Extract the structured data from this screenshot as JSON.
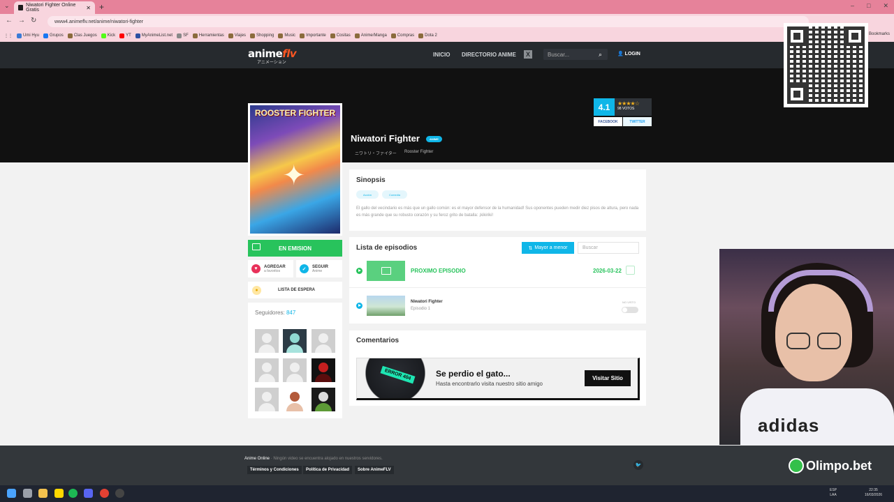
{
  "browser": {
    "tab_title": "Niwatori Fighter Online Gratis",
    "url": "www4.animeflv.net/anime/niwatori-fighter",
    "bookmarks": [
      "Umi Hyu",
      "Grupos",
      "Clas Juegos",
      "Kick",
      "YT",
      "MyAnimeList.net",
      "SF",
      "Herramientas",
      "Viajes",
      "Shopping",
      "Music",
      "Importante",
      "Cositas",
      "Anime/Manga",
      "Compras",
      "Dota 2"
    ],
    "bookmarks_right": "Bookmarks"
  },
  "site": {
    "logo_main": "anime",
    "logo_accent": "flv",
    "logo_sub": "アニメーション",
    "nav": [
      "INICIO",
      "DIRECTORIO ANIME"
    ],
    "search_placeholder": "Buscar...",
    "login": "LOGIN"
  },
  "anime": {
    "poster_title": "ROOSTER FIGHTER",
    "title": "Niwatori Fighter",
    "type": "ANIME",
    "alt_titles": [
      "ニワトリ・ファイター",
      "Rooster Fighter"
    ],
    "rating": "4.1",
    "stars": "★★★★☆",
    "votes": "98 VOTOS",
    "share": [
      "FACEBOOK",
      "TWITTER"
    ],
    "status": "EN EMISION",
    "actions": [
      {
        "label": "AGREGAR",
        "sub": "a favoritos"
      },
      {
        "label": "SEGUIR",
        "sub": "Anime"
      }
    ],
    "waitlist": "LISTA DE ESPERA",
    "followers_label": "Seguidores:",
    "followers_count": "847"
  },
  "synopsis": {
    "heading": "Sinopsis",
    "genres": [
      "Acción",
      "Comedia"
    ],
    "text": "El gallo del vecindario es más que un gallo común: es el mayor defensor de la humanidad! Sus oponentes pueden medir diez pisos de altura, pero nada es más grande que su robusto corazón y su feroz grito de batalla: ¡kikiriki!"
  },
  "episodes": {
    "heading": "Lista de episodios",
    "sort_label": "Mayor a menor",
    "search_placeholder": "Buscar",
    "next_label": "PROXIMO EPISODIO",
    "next_date": "2026-03-22",
    "items": [
      {
        "name": "Niwatori Fighter",
        "number": "Episodio 1",
        "status": "NO VISTO"
      }
    ]
  },
  "comments": {
    "heading": "Comentarios",
    "error_tag": "ERROR 404",
    "banner_title": "Se perdio el gato...",
    "banner_sub": "Hasta encontrarlo visita nuestro sitio amigo",
    "banner_button": "Visitar Sitio"
  },
  "footer": {
    "brand": "Anime Online",
    "disclaimer": "Ningún video se encuentra alojado en nuestros servidores.",
    "links": [
      "Términos y Condiciones",
      "Política de Privacidad",
      "Sobre AnimeFLV"
    ]
  },
  "overlay": {
    "sponsor": "Olimpo.bet",
    "shirt_text": "adidas"
  },
  "taskbar": {
    "lang": "ESP",
    "lang_sub": "LAA",
    "time": "22:35",
    "date": "16/03/2026"
  },
  "colors": {
    "accent": "#0fb6e8",
    "green": "#28c35c",
    "header": "#262a2e",
    "browser_frame": "#e6829a"
  }
}
